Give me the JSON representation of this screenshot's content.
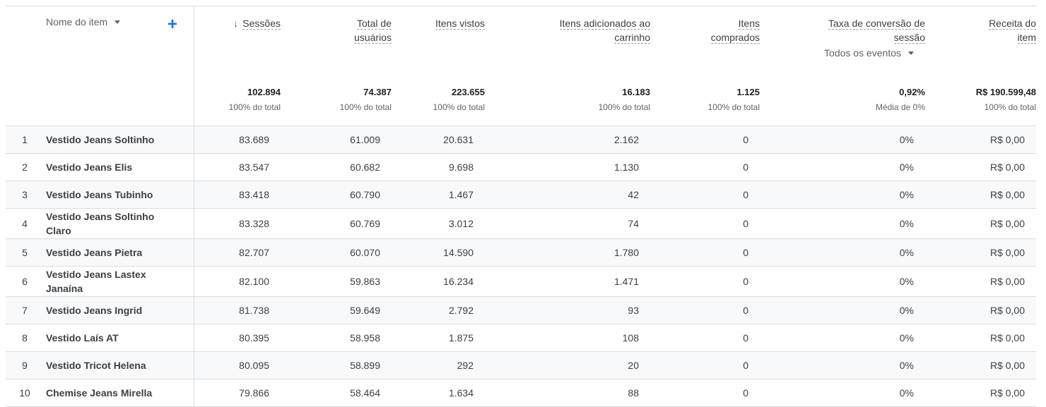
{
  "dimension": {
    "label": "Nome do item",
    "add_symbol": "+"
  },
  "columns": [
    {
      "key": "sessions",
      "label": "Sessões",
      "sort_arrow": "↓"
    },
    {
      "key": "users",
      "label": "Total de usuários"
    },
    {
      "key": "items_viewed",
      "label": "Itens vistos"
    },
    {
      "key": "items_added",
      "label": "Itens adicionados ao carrinho"
    },
    {
      "key": "items_purchased",
      "label": "Itens comprados"
    },
    {
      "key": "conversion_rate",
      "label": "Taxa de conversão de sessão",
      "selector": "Todos os eventos"
    },
    {
      "key": "revenue",
      "label": "Receita do item"
    }
  ],
  "totals": [
    {
      "value": "102.894",
      "sub": "100% do total"
    },
    {
      "value": "74.387",
      "sub": "100% do total"
    },
    {
      "value": "223.655",
      "sub": "100% do total"
    },
    {
      "value": "16.183",
      "sub": "100% do total"
    },
    {
      "value": "1.125",
      "sub": "100% do total"
    },
    {
      "value": "0,92%",
      "sub": "Média de 0%"
    },
    {
      "value": "R$ 190.599,48",
      "sub": "100% do total"
    }
  ],
  "rows": [
    {
      "idx": "1",
      "name": "Vestido Jeans Soltinho",
      "values": [
        "83.689",
        "61.009",
        "20.631",
        "2.162",
        "0",
        "0%",
        "R$ 0,00"
      ]
    },
    {
      "idx": "2",
      "name": "Vestido Jeans Elis",
      "values": [
        "83.547",
        "60.682",
        "9.698",
        "1.130",
        "0",
        "0%",
        "R$ 0,00"
      ]
    },
    {
      "idx": "3",
      "name": "Vestido Jeans Tubinho",
      "values": [
        "83.418",
        "60.790",
        "1.467",
        "42",
        "0",
        "0%",
        "R$ 0,00"
      ]
    },
    {
      "idx": "4",
      "name": "Vestido Jeans Soltinho Claro",
      "values": [
        "83.328",
        "60.769",
        "3.012",
        "74",
        "0",
        "0%",
        "R$ 0,00"
      ]
    },
    {
      "idx": "5",
      "name": "Vestido Jeans Pietra",
      "values": [
        "82.707",
        "60.070",
        "14.590",
        "1.780",
        "0",
        "0%",
        "R$ 0,00"
      ]
    },
    {
      "idx": "6",
      "name": "Vestido Jeans Lastex Janaína",
      "values": [
        "82.100",
        "59.863",
        "16.234",
        "1.471",
        "0",
        "0%",
        "R$ 0,00"
      ]
    },
    {
      "idx": "7",
      "name": "Vestido Jeans Ingrid",
      "values": [
        "81.738",
        "59.649",
        "2.792",
        "93",
        "0",
        "0%",
        "R$ 0,00"
      ]
    },
    {
      "idx": "8",
      "name": "Vestido Laís AT",
      "values": [
        "80.395",
        "58.958",
        "1.875",
        "108",
        "0",
        "0%",
        "R$ 0,00"
      ]
    },
    {
      "idx": "9",
      "name": "Vestido Tricot Helena",
      "values": [
        "80.095",
        "58.899",
        "292",
        "20",
        "0",
        "0%",
        "R$ 0,00"
      ]
    },
    {
      "idx": "10",
      "name": "Chemise Jeans Mirella",
      "values": [
        "79.866",
        "58.464",
        "1.634",
        "88",
        "0",
        "0%",
        "R$ 0,00"
      ]
    }
  ]
}
